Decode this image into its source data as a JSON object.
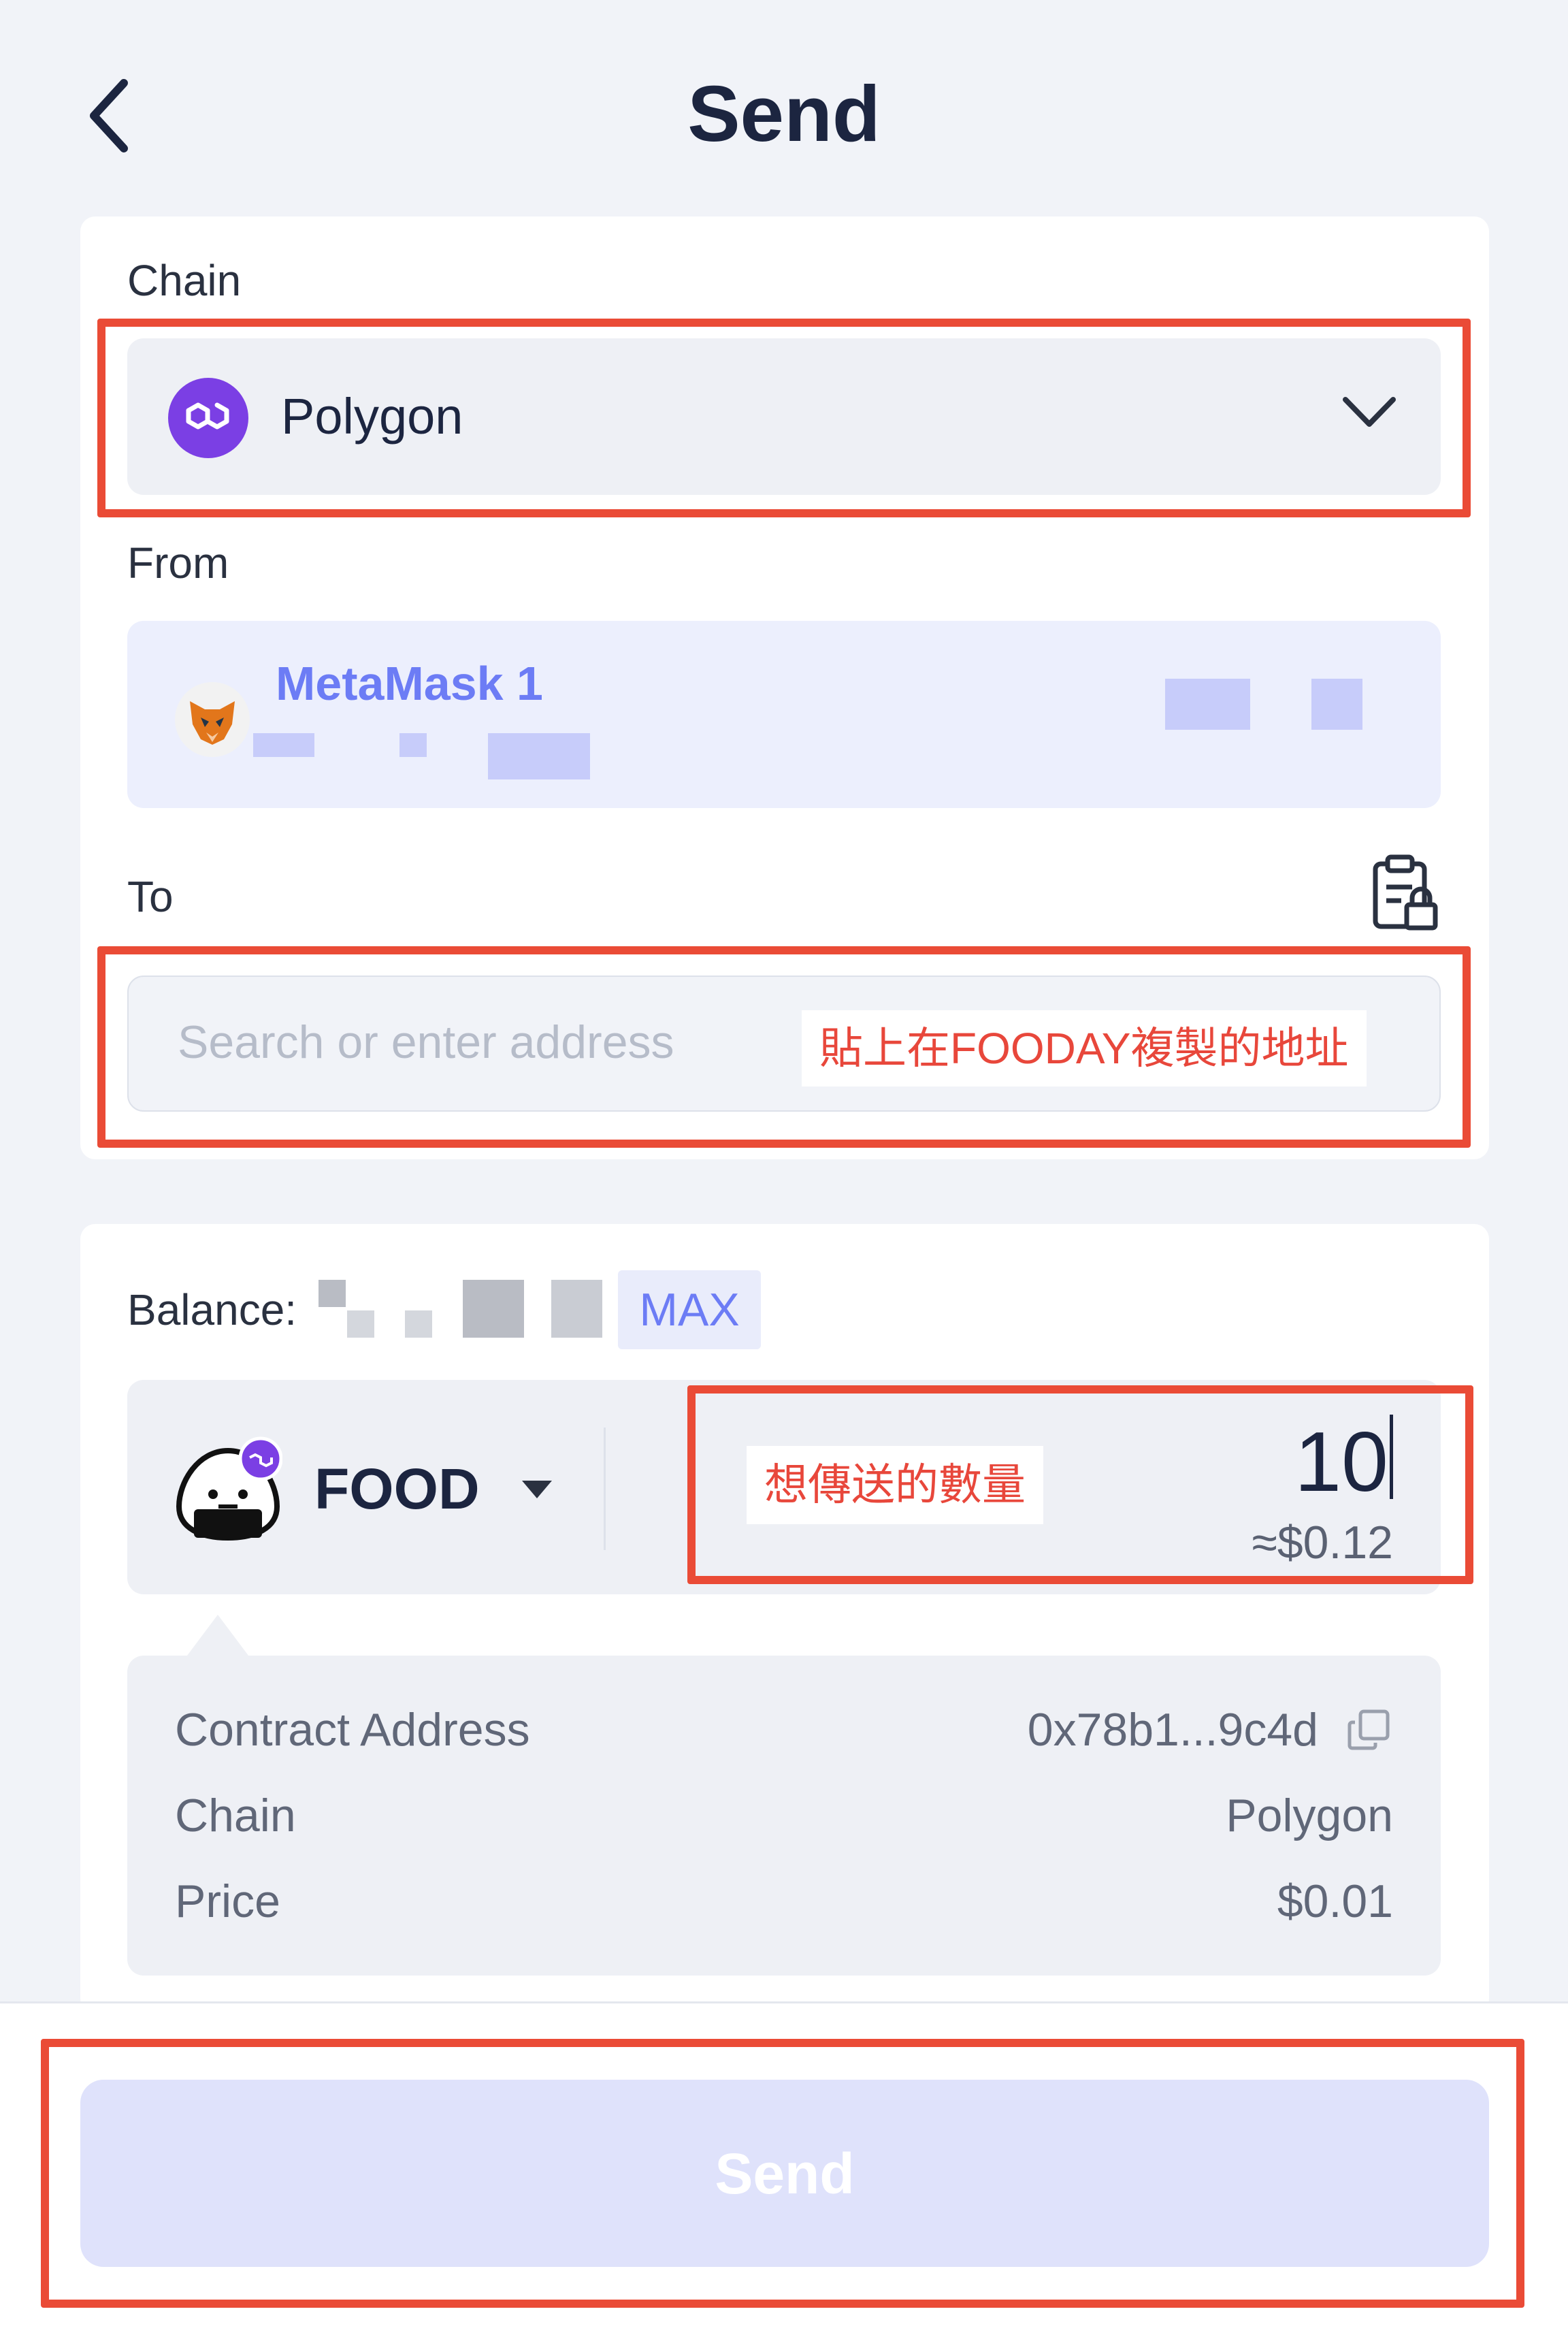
{
  "header": {
    "title": "Send",
    "back_icon": "chevron-left-icon"
  },
  "chain": {
    "label": "Chain",
    "selected": "Polygon",
    "icon": "polygon-icon"
  },
  "from": {
    "label": "From",
    "account_name": "MetaMask 1",
    "icon": "metamask-fox-icon"
  },
  "to": {
    "label": "To",
    "placeholder": "Search or enter address",
    "annotation": "貼上在FOODAY複製的地址",
    "paste_icon": "clipboard-icon"
  },
  "balance": {
    "label": "Balance:",
    "max_label": "MAX"
  },
  "token": {
    "symbol": "FOOD",
    "amount": "10",
    "usd_value": "≈$0.12",
    "annotation": "想傳送的數量"
  },
  "info": {
    "rows": [
      {
        "label": "Contract Address",
        "value": "0x78b1...9c4d"
      },
      {
        "label": "Chain",
        "value": "Polygon"
      },
      {
        "label": "Price",
        "value": "$0.01"
      }
    ]
  },
  "footer": {
    "send_label": "Send",
    "send_enabled": false
  },
  "colors": {
    "accent": "#6c7cf5",
    "highlight": "#ea4b36",
    "polygon": "#7b3fe4",
    "disabled_button": "#dfe2fb"
  }
}
